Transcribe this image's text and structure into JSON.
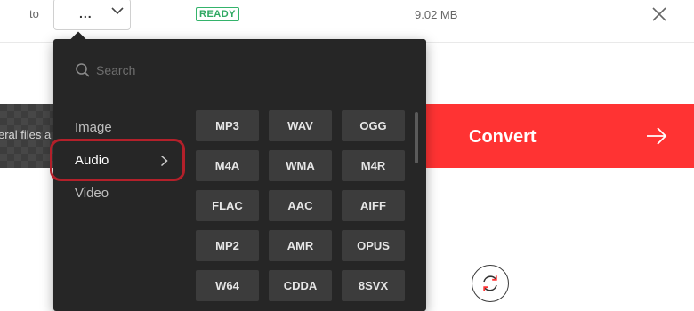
{
  "file_row": {
    "to_label": "to",
    "format_value": "...",
    "status_badge": "READY",
    "file_size": "9.02 MB"
  },
  "background": {
    "add_files_text": "eral files a",
    "convert_label": "Convert"
  },
  "dropdown": {
    "search_placeholder": "Search",
    "categories": [
      {
        "label": "Image",
        "active": false
      },
      {
        "label": "Audio",
        "active": true
      },
      {
        "label": "Video",
        "active": false
      }
    ],
    "formats": [
      "MP3",
      "WAV",
      "OGG",
      "M4A",
      "WMA",
      "M4R",
      "FLAC",
      "AAC",
      "AIFF",
      "MP2",
      "AMR",
      "OPUS",
      "W64",
      "CDDA",
      "8SVX"
    ]
  },
  "colors": {
    "accent": "#ff3333",
    "panel": "#262626",
    "tile": "#3c3c3c",
    "ready": "#2fa862",
    "highlight": "#b3202a"
  },
  "icons": {
    "format_select": "chevron-down-icon",
    "close": "close-icon",
    "convert": "arrow-right-icon",
    "refresh": "refresh-icon",
    "search": "search-icon",
    "category": "chevron-right-icon"
  }
}
